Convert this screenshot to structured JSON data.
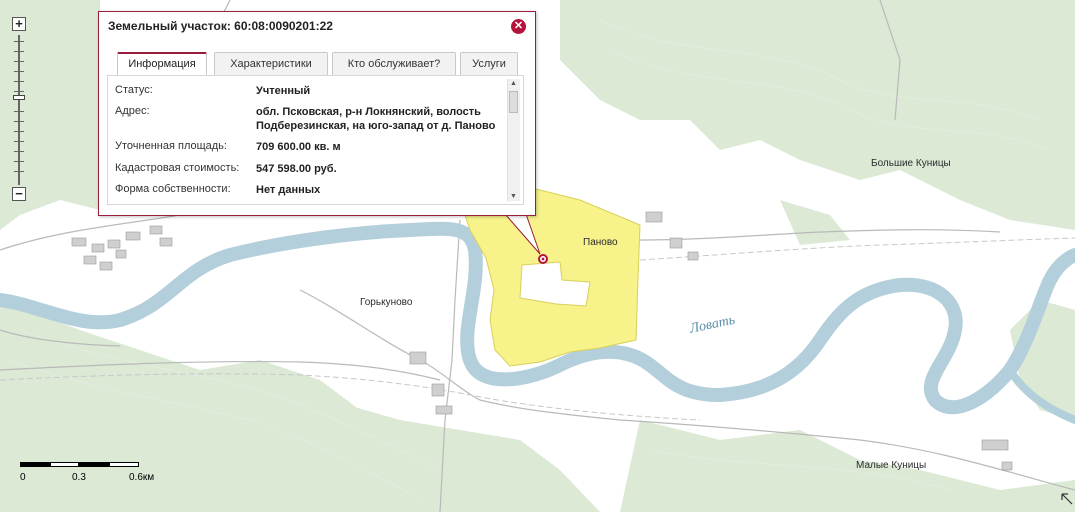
{
  "popup": {
    "title": "Земельный участок: 60:08:0090201:22",
    "close_icon": "close-icon",
    "tabs": [
      {
        "label": "Информация",
        "active": true
      },
      {
        "label": "Характеристики",
        "active": false
      },
      {
        "label": "Кто обслуживает?",
        "active": false
      },
      {
        "label": "Услуги",
        "active": false
      }
    ],
    "fields": [
      {
        "key": "Статус:",
        "value": "Учтенный"
      },
      {
        "key": "Адрес:",
        "value": "обл. Псковская, р-н Локнянский, волость Подберезинская, на юго-запад от д. Паново"
      },
      {
        "key": "Уточненная площадь:",
        "value": "709 600.00 кв. м"
      },
      {
        "key": "Кадастровая стоимость:",
        "value": "547 598.00 руб."
      },
      {
        "key": "Форма собственности:",
        "value": "Нет данных"
      }
    ]
  },
  "map": {
    "places": {
      "bolshie_kunitsy": "Большие Куницы",
      "panovo": "Паново",
      "gorkunovo": "Горькуново",
      "malye_kunitsy": "Малые Куницы"
    },
    "river": "Ловать",
    "parcel_color": "#f7f28a",
    "river_color": "#b3cfdb",
    "forest_color": "#d9e8d3",
    "marker_color": "#b4143c"
  },
  "zoom": {
    "in_label": "+",
    "out_label": "−"
  },
  "scale": {
    "labels": [
      "0",
      "0.3",
      "0.6км"
    ]
  },
  "resize_icon": "resize-icon"
}
